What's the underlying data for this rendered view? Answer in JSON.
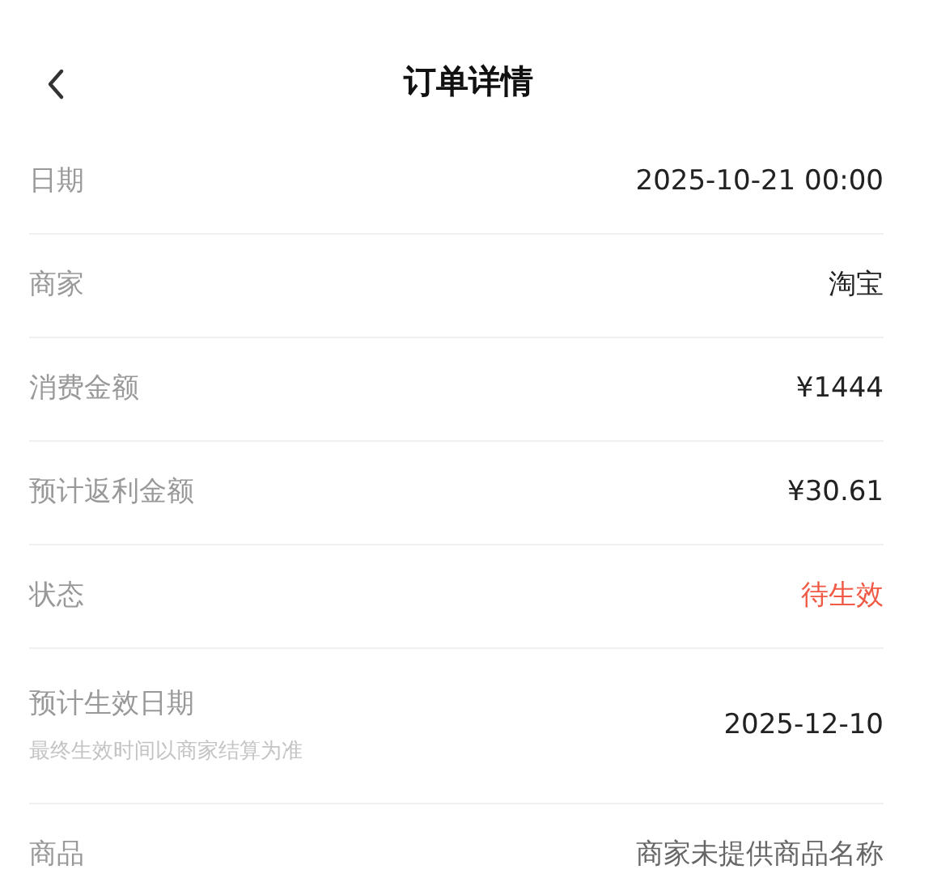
{
  "header": {
    "title": "订单详情"
  },
  "rows": [
    {
      "label": "日期",
      "value": "2025-10-21 00:00",
      "kind": "plain"
    },
    {
      "label": "商家",
      "value": "淘宝",
      "kind": "plain"
    },
    {
      "label": "消费金额",
      "value": "¥1444",
      "kind": "plain"
    },
    {
      "label": "预计返利金额",
      "value": "¥30.61",
      "kind": "plain"
    },
    {
      "label": "状态",
      "value": "待生效",
      "kind": "status"
    },
    {
      "label": "预计生效日期",
      "note": "最终生效时间以商家结算为准",
      "value": "2025-12-10",
      "kind": "plain"
    },
    {
      "label": "商品",
      "value": "商家未提供商品名称",
      "kind": "muted"
    }
  ]
}
